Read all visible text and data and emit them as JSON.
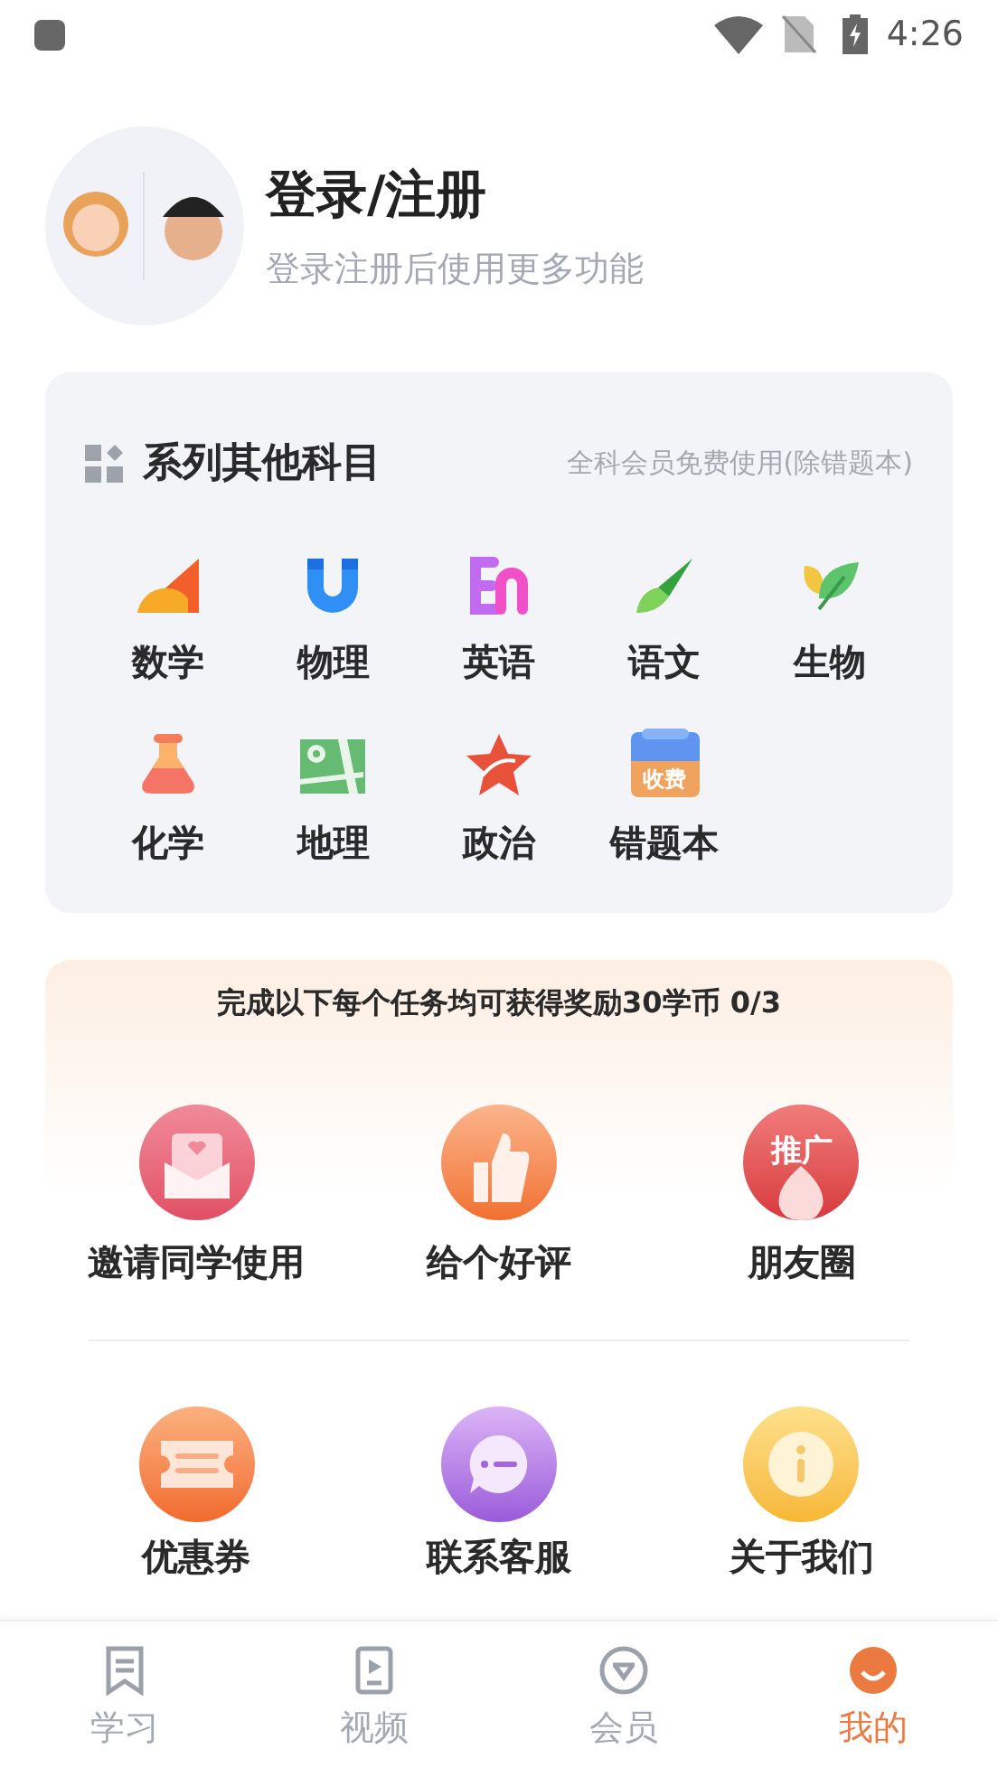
{
  "status_bar": {
    "time": "4:26"
  },
  "profile": {
    "title": "登录/注册",
    "subtitle": "登录注册后使用更多功能"
  },
  "subjects": {
    "title": "系列其他科目",
    "note": "全科会员免费使用(除错题本)",
    "items": [
      {
        "label": "数学",
        "kind": "math"
      },
      {
        "label": "物理",
        "kind": "physics"
      },
      {
        "label": "英语",
        "kind": "english"
      },
      {
        "label": "语文",
        "kind": "chinese"
      },
      {
        "label": "生物",
        "kind": "biology"
      },
      {
        "label": "化学",
        "kind": "chemistry"
      },
      {
        "label": "地理",
        "kind": "geography"
      },
      {
        "label": "政治",
        "kind": "politics"
      },
      {
        "label": "错题本",
        "kind": "notebook",
        "badge": "收费"
      }
    ]
  },
  "tasks": {
    "title": "完成以下每个任务均可获得奖励30学币 0/3",
    "items": [
      {
        "label": "邀请同学使用",
        "kind": "invite"
      },
      {
        "label": "给个好评",
        "kind": "like"
      },
      {
        "label": "朋友圈",
        "kind": "share",
        "badge": "推广"
      }
    ]
  },
  "services": [
    {
      "label": "优惠券",
      "kind": "coupon"
    },
    {
      "label": "联系客服",
      "kind": "service"
    },
    {
      "label": "关于我们",
      "kind": "about"
    }
  ],
  "tab_bar": [
    {
      "label": "学习",
      "kind": "study",
      "selected": false
    },
    {
      "label": "视频",
      "kind": "video",
      "selected": false
    },
    {
      "label": "会员",
      "kind": "vip",
      "selected": false
    },
    {
      "label": "我的",
      "kind": "me",
      "selected": true
    }
  ]
}
